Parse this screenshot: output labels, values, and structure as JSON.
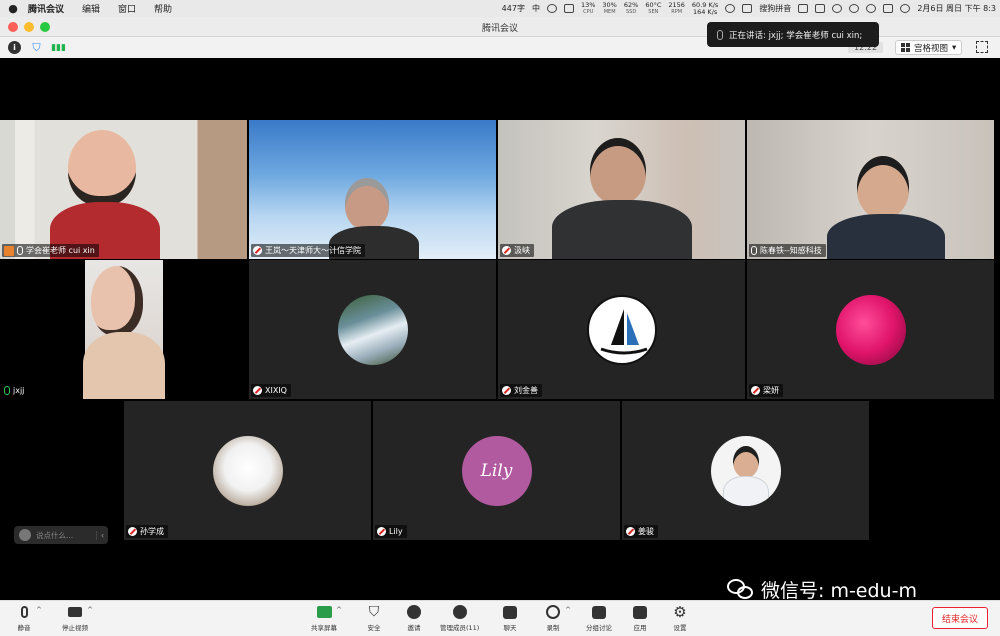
{
  "menubar": {
    "app_name": "腾讯会议",
    "menus": [
      "编辑",
      "窗口",
      "帮助"
    ],
    "word_count": "447字",
    "input_method_short": "中",
    "cpu": {
      "value": "13%",
      "label": "CPU"
    },
    "mem": {
      "value": "30%",
      "label": "MEM"
    },
    "ssd": {
      "value": "62%",
      "label": "SSD"
    },
    "temp": {
      "value": "60°C",
      "label": "SEN"
    },
    "rpm": {
      "value": "2156",
      "label": "RPM"
    },
    "net_up": "60.9 K/s",
    "net_down": "164 K/s",
    "input_method": "搜狗拼音",
    "datetime": "2月6日 周日 下午 8:3"
  },
  "window": {
    "title": "腾讯会议"
  },
  "topbar": {
    "timer": "12:22",
    "view_label": "宫格视图"
  },
  "speaking": {
    "text": "正在讲话: jxjj; 学会崔老师 cui xin;"
  },
  "participants": [
    {
      "name": "学会崔老师 cui xin",
      "state": "host"
    },
    {
      "name": "王岚～天津师大～计信学院",
      "state": "muted"
    },
    {
      "name": "汲峡",
      "state": "muted"
    },
    {
      "name": "陈春铁--知感科技",
      "state": "mic"
    },
    {
      "name": "jxjj",
      "state": "speaking"
    },
    {
      "name": "XIXIQ",
      "state": "muted"
    },
    {
      "name": "刘金善",
      "state": "muted"
    },
    {
      "name": "梁妍",
      "state": "muted"
    },
    {
      "name": "孙学成",
      "state": "muted"
    },
    {
      "name": "Lily",
      "state": "muted"
    },
    {
      "name": "姜骏",
      "state": "muted"
    }
  ],
  "avatars": {
    "lily_text": "Lily"
  },
  "chat": {
    "placeholder": "说点什么..."
  },
  "watermark": {
    "text": "微信号: m-edu-m"
  },
  "toolbar": {
    "mute": "静音",
    "video": "停止视频",
    "share": "共享屏幕",
    "security": "安全",
    "invite": "邀请",
    "members": "管理成员(11)",
    "chat": "聊天",
    "record": "录制",
    "breakout": "分组讨论",
    "apps": "应用",
    "settings": "设置",
    "end": "结束会议"
  }
}
